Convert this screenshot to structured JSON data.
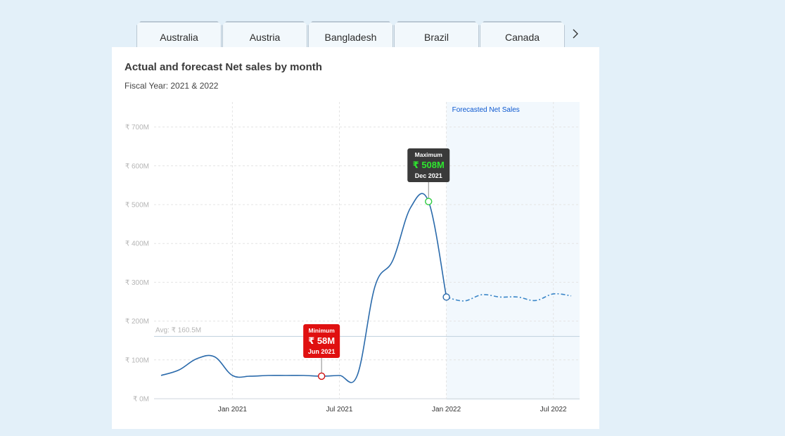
{
  "tabs": {
    "items": [
      "Australia",
      "Austria",
      "Bangladesh",
      "Brazil",
      "Canada"
    ],
    "next_icon": "chevron-right-icon"
  },
  "card": {
    "title": "Actual and forecast Net sales by month",
    "subtitle": "Fiscal Year: 2021 & 2022"
  },
  "chart_data": {
    "type": "line",
    "title": "Actual and forecast Net sales by month",
    "subtitle": "Fiscal Year: 2021 & 2022",
    "xlabel": "",
    "ylabel": "",
    "ylim": [
      0,
      750
    ],
    "y_ticks": [
      0,
      100,
      200,
      300,
      400,
      500,
      600,
      700
    ],
    "y_tick_labels": [
      "₹ 0M",
      "₹ 100M",
      "₹ 200M",
      "₹ 300M",
      "₹ 400M",
      "₹ 500M",
      "₹ 600M",
      "₹ 700M"
    ],
    "x_ticks": [
      "2021-01",
      "2021-07",
      "2022-01",
      "2022-07"
    ],
    "x_tick_labels": [
      "Jan 2021",
      "Jul 2021",
      "Jan 2022",
      "Jul 2022"
    ],
    "grid": true,
    "series": [
      {
        "style": "solid",
        "color": "#2a6aab",
        "x": [
          "2020-09",
          "2020-10",
          "2020-11",
          "2020-12",
          "2021-01",
          "2021-02",
          "2021-03",
          "2021-04",
          "2021-05",
          "2021-06",
          "2021-07",
          "2021-08",
          "2021-09",
          "2021-10",
          "2021-11",
          "2021-12",
          "2022-01"
        ],
        "values": [
          60,
          74,
          103,
          108,
          60,
          58,
          60,
          60,
          60,
          58,
          60,
          60,
          290,
          357,
          493,
          508,
          262
        ]
      },
      {
        "style": "dash-dot",
        "color": "#3a86c8",
        "x": [
          "2022-01",
          "2022-02",
          "2022-03",
          "2022-04",
          "2022-05",
          "2022-06",
          "2022-07",
          "2022-08"
        ],
        "values": [
          262,
          252,
          268,
          262,
          262,
          253,
          270,
          265
        ]
      }
    ],
    "forecast_region": {
      "start": "2022-01",
      "label": "Forecasted Net Sales",
      "color": "#0b57d0"
    },
    "average_line": {
      "value": 160.5,
      "label": "Avg: ₹ 160.5M"
    },
    "annotations": [
      {
        "type": "minimum",
        "x": "2021-06",
        "y": 58,
        "heading": "Minimum",
        "value_label": "₹ 58M",
        "date_label": "Jun 2021",
        "color": "#e01010"
      },
      {
        "type": "maximum",
        "x": "2021-12",
        "y": 508,
        "heading": "Maximum",
        "value_label": "₹ 508M",
        "date_label": "Dec 2021",
        "color": "#3a3a3a",
        "value_color": "#2ee62e"
      }
    ]
  }
}
